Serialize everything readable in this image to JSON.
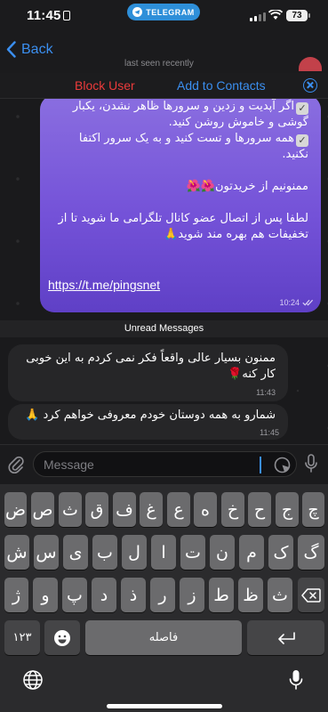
{
  "status": {
    "time": "11:45",
    "app_pill": "TELEGRAM",
    "battery": "73"
  },
  "nav": {
    "back_label": "Back",
    "last_seen": "last seen recently"
  },
  "actions": {
    "block": "Block User",
    "add_contact": "Add to Contacts"
  },
  "messages": {
    "outgoing": {
      "lines": [
        "اگر آپدیت و زدین و سرورها ظاهر نشدن، یکبار",
        "گوشی و خاموش روشن کنید.",
        "همه سرورها و تست کنید و به یک سرور اکتفا",
        "نکنید.",
        "",
        "ممنونیم از خریدتون🌺🌺",
        "",
        "لطفا پس از اتصال عضو کانال تلگرامی ما شوید تا از",
        "تخفیفات هم بهره مند شوید🙏",
        ""
      ],
      "link": "https://t.me/pingsnet",
      "time": "10:24"
    },
    "unread_label": "Unread Messages",
    "incoming": [
      {
        "lines": [
          "ممنون بسیار عالی  واقعاً فکر نمی کردم به این خوبی",
          "کار کنه🌹"
        ],
        "time": "11:43"
      },
      {
        "lines": [
          "شمارو به همه دوستان خودم معروفی خواهم کرد 🙏"
        ],
        "time": "11:45"
      }
    ]
  },
  "input": {
    "placeholder": "Message"
  },
  "keyboard": {
    "row1": [
      "چ",
      "ج",
      "ح",
      "خ",
      "ه",
      "ع",
      "غ",
      "ف",
      "ق",
      "ث",
      "ص",
      "ض"
    ],
    "row2": [
      "گ",
      "ک",
      "م",
      "ن",
      "ت",
      "ا",
      "ل",
      "ب",
      "ی",
      "س",
      "ش"
    ],
    "row3": [
      "ظ",
      "ط",
      "ز",
      "ر",
      "ذ",
      "د",
      "پ",
      "و",
      "ژ"
    ],
    "numbers": "۱۲۳",
    "space": "فاصله"
  },
  "colors": {
    "accent": "#3b8ff0",
    "danger": "#ec3b3b",
    "bubble_out": "#7452d8",
    "bubble_in": "#262628"
  }
}
